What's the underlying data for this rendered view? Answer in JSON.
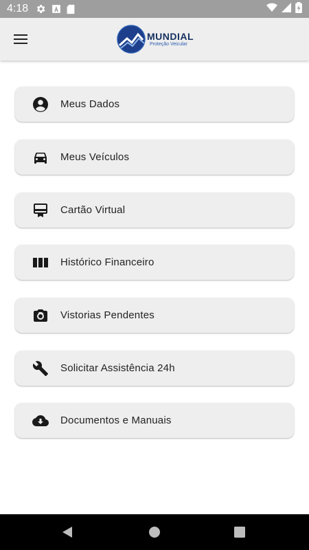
{
  "status_bar": {
    "time": "4:18",
    "left_icons": [
      "settings-icon",
      "text-a-icon",
      "sd-card-icon"
    ],
    "right_icons": [
      "wifi-icon",
      "signal-icon",
      "battery-icon"
    ]
  },
  "app_bar": {
    "menu_icon": "hamburger-menu-icon",
    "logo_title": "MUNDIAL",
    "logo_subtitle": "Proteção Veicular"
  },
  "menu": {
    "items": [
      {
        "label": "Meus Dados",
        "icon": "account-circle-icon"
      },
      {
        "label": "Meus Veículos",
        "icon": "car-icon"
      },
      {
        "label": "Cartão Virtual",
        "icon": "card-membership-icon"
      },
      {
        "label": "Histórico Financeiro",
        "icon": "columns-icon"
      },
      {
        "label": "Vistorias Pendentes",
        "icon": "camera-switch-icon"
      },
      {
        "label": "Solicitar Assistência 24h",
        "icon": "wrench-icon"
      },
      {
        "label": "Documentos e Manuais",
        "icon": "cloud-download-icon"
      }
    ]
  },
  "nav_bar": {
    "buttons": [
      "back-icon",
      "home-icon",
      "recents-icon"
    ]
  },
  "colors": {
    "status_bar": "#9e9e9e",
    "app_bar": "#eeeeee",
    "card": "#eeeeee",
    "logo_dark": "#14305f",
    "logo_blue": "#2a5db0",
    "text": "#222222"
  }
}
